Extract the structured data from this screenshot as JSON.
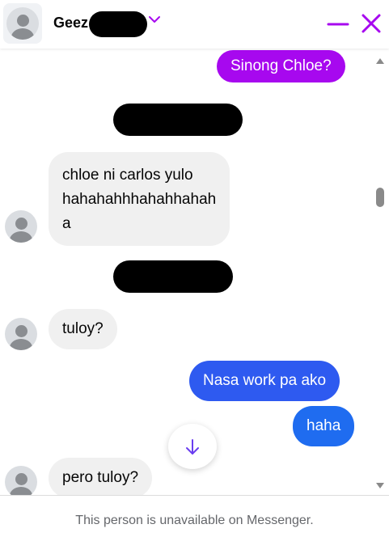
{
  "header": {
    "contact_name": "Geez",
    "chevron_icon": "chevron-down-icon",
    "minimize_icon": "minimize-icon",
    "close_icon": "close-icon",
    "accent_color": "#a708ef"
  },
  "messages": [
    {
      "direction": "out",
      "text": "Sinong Chloe?",
      "color": "#a708ef"
    },
    {
      "direction": "in",
      "lines": [
        "chloe ni carlos yulo",
        "hahahahhhahahhahah",
        "a"
      ]
    },
    {
      "direction": "in",
      "text": "tuloy?"
    },
    {
      "direction": "out",
      "text": "Nasa work pa ako",
      "color": "#2e5af0"
    },
    {
      "direction": "out",
      "text": "haha",
      "color": "#1f6cf0"
    },
    {
      "direction": "in",
      "text": "pero tuloy?"
    }
  ],
  "scroll_down_icon": "arrow-down-icon",
  "footer": {
    "notice": "This person is unavailable on Messenger."
  }
}
